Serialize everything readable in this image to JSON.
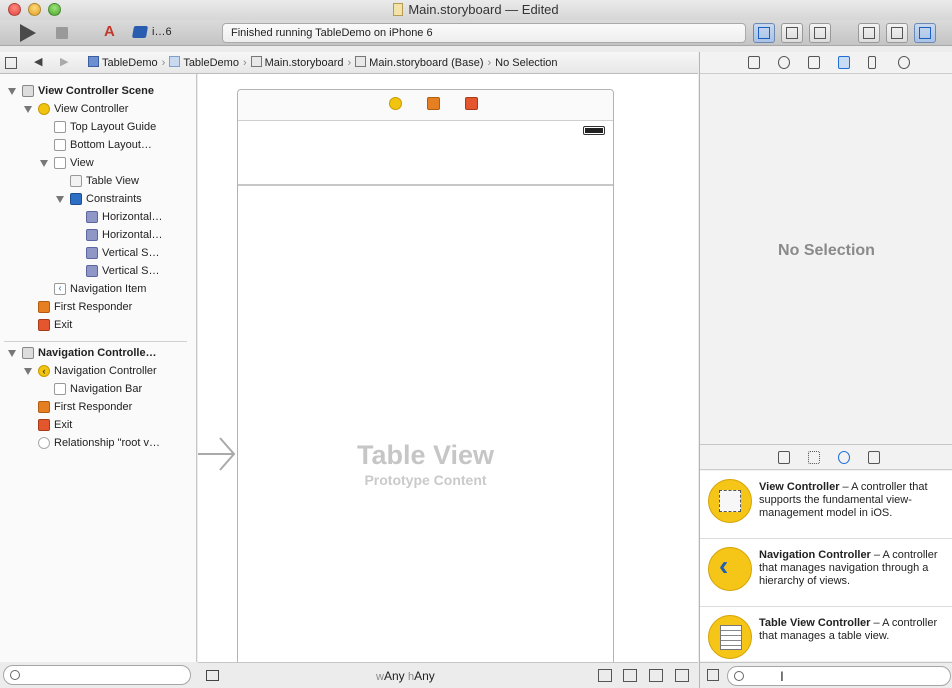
{
  "window": {
    "title": "Main.storyboard — Edited"
  },
  "toolbar": {
    "scheme_label": "i…6",
    "activity": "Finished running TableDemo on iPhone 6"
  },
  "jumpbar": {
    "crumbs": [
      "TableDemo",
      "TableDemo",
      "Main.storyboard",
      "Main.storyboard (Base)",
      "No Selection"
    ]
  },
  "outline": {
    "items": [
      {
        "label": "View Controller Scene",
        "indent": 0,
        "disclosure": true,
        "icon": "scene-icon",
        "bold": true
      },
      {
        "label": "View Controller",
        "indent": 1,
        "disclosure": true,
        "icon": "view-controller-icon"
      },
      {
        "label": "Top Layout Guide",
        "indent": 2,
        "disclosure": false,
        "icon": "layout-guide-icon"
      },
      {
        "label": "Bottom Layout…",
        "indent": 2,
        "disclosure": false,
        "icon": "layout-guide-icon"
      },
      {
        "label": "View",
        "indent": 2,
        "disclosure": true,
        "icon": "view-icon"
      },
      {
        "label": "Table View",
        "indent": 3,
        "disclosure": false,
        "icon": "table-view-icon"
      },
      {
        "label": "Constraints",
        "indent": 3,
        "disclosure": true,
        "icon": "constraints-icon"
      },
      {
        "label": "Horizontal…",
        "indent": 4,
        "disclosure": false,
        "icon": "constraint-icon"
      },
      {
        "label": "Horizontal…",
        "indent": 4,
        "disclosure": false,
        "icon": "constraint-icon"
      },
      {
        "label": "Vertical S…",
        "indent": 4,
        "disclosure": false,
        "icon": "constraint-icon"
      },
      {
        "label": "Vertical S…",
        "indent": 4,
        "disclosure": false,
        "icon": "constraint-icon"
      },
      {
        "label": "Navigation Item",
        "indent": 2,
        "disclosure": false,
        "icon": "navigation-item-icon"
      },
      {
        "label": "First Responder",
        "indent": 1,
        "disclosure": false,
        "icon": "first-responder-icon"
      },
      {
        "label": "Exit",
        "indent": 1,
        "disclosure": false,
        "icon": "exit-icon"
      },
      {
        "label": "Navigation Controlle…",
        "indent": 0,
        "disclosure": true,
        "icon": "scene-icon",
        "bold": true
      },
      {
        "label": "Navigation Controller",
        "indent": 1,
        "disclosure": true,
        "icon": "navigation-controller-icon"
      },
      {
        "label": "Navigation Bar",
        "indent": 2,
        "disclosure": false,
        "icon": "navigation-bar-icon"
      },
      {
        "label": "First Responder",
        "indent": 1,
        "disclosure": false,
        "icon": "first-responder-icon"
      },
      {
        "label": "Exit",
        "indent": 1,
        "disclosure": false,
        "icon": "exit-icon"
      },
      {
        "label": "Relationship \"root v…",
        "indent": 1,
        "disclosure": false,
        "icon": "relationship-icon"
      }
    ]
  },
  "canvas": {
    "table_view_title": "Table View",
    "table_view_subtitle": "Prototype Content",
    "size_class_w_letter": "w",
    "size_class_w": "Any",
    "size_class_h_letter": "h",
    "size_class_h": "Any"
  },
  "inspector": {
    "empty_label": "No Selection"
  },
  "library": {
    "items": [
      {
        "name": "View Controller",
        "desc": " – A controller that supports the fundamental view-management model in iOS.",
        "icon": "view-controller-icon"
      },
      {
        "name": "Navigation Controller",
        "desc": " – A controller that manages navigation through a hierarchy of views.",
        "icon": "navigation-controller-icon"
      },
      {
        "name": "Table View Controller",
        "desc": " – A controller that manages a table view.",
        "icon": "table-view-controller-icon"
      }
    ]
  },
  "colors": {
    "accent": "#1f6fd6",
    "view_controller_yellow": "#f1c40f",
    "first_responder_orange": "#e67e22",
    "exit_red": "#e4572e"
  }
}
